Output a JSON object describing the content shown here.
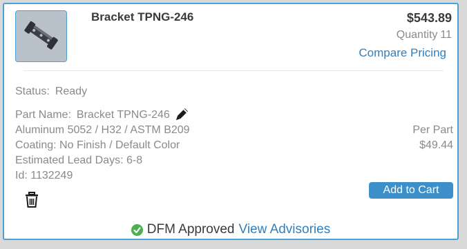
{
  "item": {
    "title": "Bracket TPNG-246",
    "price": "$543.89",
    "quantity_label": "Quantity",
    "quantity_value": "11",
    "compare_label": "Compare Pricing"
  },
  "details": {
    "status_label": "Status:",
    "status_value": "Ready",
    "part_name_label": "Part Name:",
    "part_name_value": "Bracket TPNG-246",
    "material": "Aluminum 5052 / H32 / ASTM B209",
    "coating": "Coating: No Finish / Default Color",
    "lead_days": "Estimated Lead Days: 6-8",
    "id": "Id: 1132249"
  },
  "pricing": {
    "per_part_label": "Per Part",
    "per_part_value": "$49.44"
  },
  "actions": {
    "add_to_cart": "Add to Cart"
  },
  "dfm": {
    "status": "DFM Approved",
    "advisories_link": "View Advisories"
  },
  "icons": {
    "thumbnail": "bracket-part-thumbnail",
    "edit": "pencil-icon",
    "delete": "trash-icon",
    "approved": "check-circle-icon"
  },
  "colors": {
    "accent": "#4a9fd4",
    "link": "#2f7fbf",
    "button": "#3c8fc8",
    "approved": "#4caf50",
    "muted_text": "#8a8a8a"
  }
}
